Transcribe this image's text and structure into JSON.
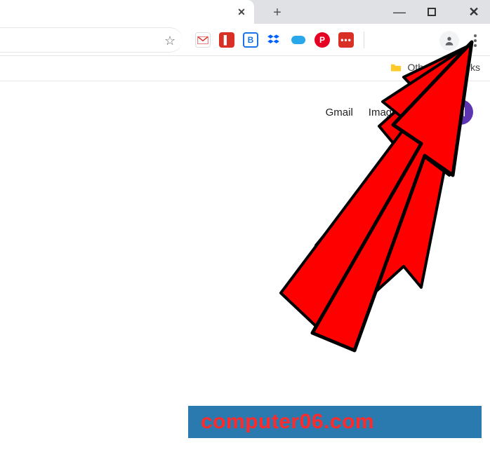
{
  "tabstrip": {
    "close_glyph": "✕",
    "newtab_glyph": "+",
    "win_min_glyph": "—",
    "win_close_glyph": "✕"
  },
  "toolbar": {
    "star_glyph": "☆",
    "extensions": [
      {
        "name": "gmail-extension"
      },
      {
        "name": "red-extension-1",
        "glyph": "▌"
      },
      {
        "name": "blue-badge-extension",
        "glyph": "B"
      },
      {
        "name": "dropbox-extension"
      },
      {
        "name": "onedrive-extension"
      },
      {
        "name": "pinterest-extension",
        "glyph": "P"
      },
      {
        "name": "lastpass-extension",
        "glyph": "•••"
      }
    ]
  },
  "bookmarks": {
    "other_label_visible": "Oth              arks"
  },
  "content": {
    "gmail_label": "Gmail",
    "images_label": "Images",
    "avatar_initial": "M"
  },
  "watermark": {
    "text": "computer06.com"
  },
  "colors": {
    "arrow_fill": "#ff0000",
    "arrow_stroke": "#000000",
    "watermark_bg": "#2a7ab0",
    "watermark_text": "#ff2b2b",
    "avatar_bg": "#5e35b1"
  }
}
